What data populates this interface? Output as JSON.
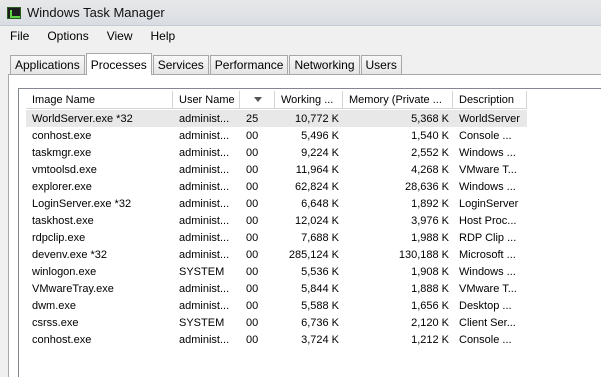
{
  "window": {
    "title": "Windows Task Manager"
  },
  "menu": [
    "File",
    "Options",
    "View",
    "Help"
  ],
  "tabs": [
    {
      "label": "Applications",
      "active": false
    },
    {
      "label": "Processes",
      "active": true
    },
    {
      "label": "Services",
      "active": false
    },
    {
      "label": "Performance",
      "active": false
    },
    {
      "label": "Networking",
      "active": false
    },
    {
      "label": "Users",
      "active": false
    }
  ],
  "table": {
    "columns": [
      "Image Name",
      "User Name",
      "",
      "Working ...",
      "Memory (Private ...",
      "Description"
    ],
    "sort_column": 2,
    "rows": [
      [
        "WorldServer.exe *32",
        "administ...",
        "25",
        "10,772 K",
        "5,368 K",
        "WorldServer"
      ],
      [
        "conhost.exe",
        "administ...",
        "00",
        "5,496 K",
        "1,540 K",
        "Console ..."
      ],
      [
        "taskmgr.exe",
        "administ...",
        "00",
        "9,224 K",
        "2,552 K",
        "Windows ..."
      ],
      [
        "vmtoolsd.exe",
        "administ...",
        "00",
        "11,964 K",
        "4,268 K",
        "VMware T..."
      ],
      [
        "explorer.exe",
        "administ...",
        "00",
        "62,824 K",
        "28,636 K",
        "Windows ..."
      ],
      [
        "LoginServer.exe *32",
        "administ...",
        "00",
        "6,648 K",
        "1,892 K",
        "LoginServer"
      ],
      [
        "taskhost.exe",
        "administ...",
        "00",
        "12,024 K",
        "3,976 K",
        "Host Proc..."
      ],
      [
        "rdpclip.exe",
        "administ...",
        "00",
        "7,688 K",
        "1,988 K",
        "RDP Clip ..."
      ],
      [
        "devenv.exe *32",
        "administ...",
        "00",
        "285,124 K",
        "130,188 K",
        "Microsoft ..."
      ],
      [
        "winlogon.exe",
        "SYSTEM",
        "00",
        "5,536 K",
        "1,908 K",
        "Windows ..."
      ],
      [
        "VMwareTray.exe",
        "administ...",
        "00",
        "5,844 K",
        "1,888 K",
        "VMware T..."
      ],
      [
        "dwm.exe",
        "administ...",
        "00",
        "5,588 K",
        "1,656 K",
        "Desktop ..."
      ],
      [
        "csrss.exe",
        "SYSTEM",
        "00",
        "6,736 K",
        "2,120 K",
        "Client Ser..."
      ],
      [
        "conhost.exe",
        "administ...",
        "00",
        "3,724 K",
        "1,212 K",
        "Console ..."
      ]
    ],
    "selected_row": 0
  }
}
